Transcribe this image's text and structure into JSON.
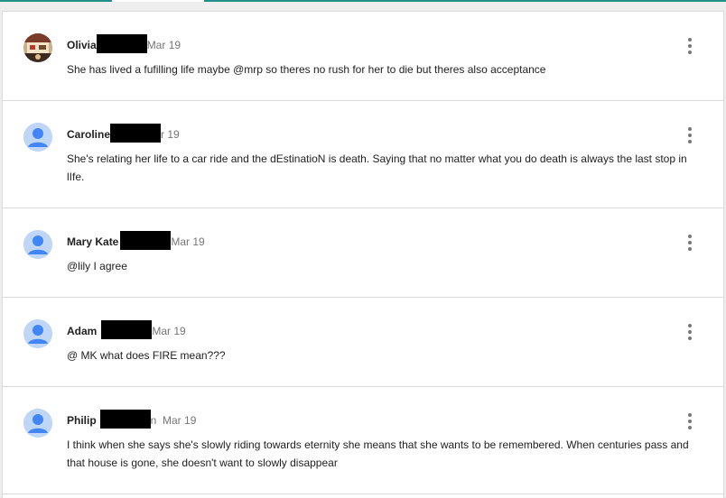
{
  "comments": [
    {
      "author": "Olivia",
      "date": "Mar 19",
      "text": "She has lived a fufilling life maybe @mrp so theres no rush for her to die but theres also acceptance",
      "avatar": "photo"
    },
    {
      "author": "Caroline",
      "date": "r 19",
      "text": "She's relating her life to a car ride and the dEstinatioN is death. Saying that no matter what you do death is always the last stop in lIfe.",
      "avatar": "default"
    },
    {
      "author": "Mary Kate",
      "date": "Mar 19",
      "text": "@lily I agree",
      "avatar": "default"
    },
    {
      "author": "Adam",
      "date": "Mar 19",
      "text": "@ MK what does FIRE mean???",
      "avatar": "default"
    },
    {
      "author": "Philip",
      "date": "n  Mar 19",
      "text": "I think when she says she's slowly riding towards eternity she means that she wants to be remembered. When centuries pass and that house is gone, she doesn't want to slowly disappear",
      "avatar": "default"
    }
  ],
  "colors": {
    "accent": "#1e8e87",
    "avatar_default_bg": "#bfd6f7",
    "avatar_default_fg": "#4285f4",
    "divider": "#dadada"
  },
  "icons": {
    "more": "more-vert-icon",
    "avatar": "person-icon"
  }
}
